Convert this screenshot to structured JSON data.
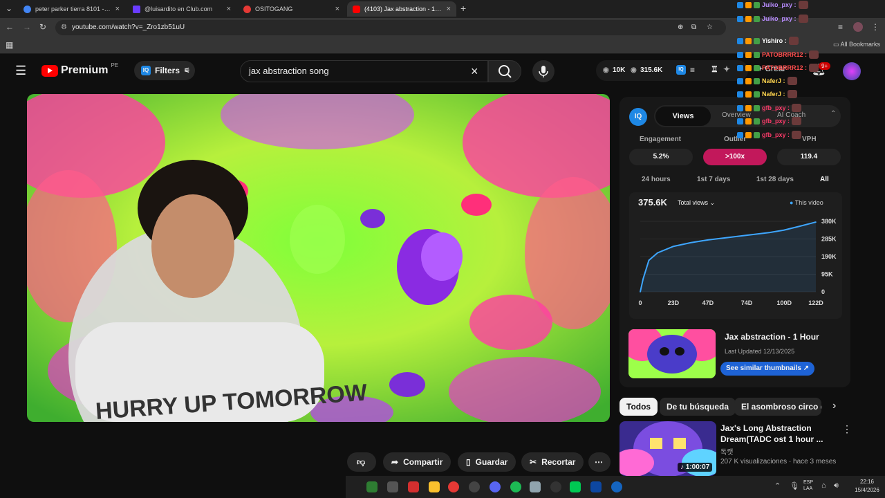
{
  "browser": {
    "tabs": [
      {
        "label": "peter parker tierra 8101 - Busca",
        "color": "#4285f4"
      },
      {
        "label": "@luisardito en Club.com",
        "color": "#6a3cff"
      },
      {
        "label": "OSITOGANG",
        "color": "#e53935"
      },
      {
        "label": "(4103) Jax abstraction - 1 Hour",
        "color": "#ff0000"
      }
    ],
    "url": "youtube.com/watch?v=_Zro1zb51uU",
    "all_bookmarks": "All Bookmarks"
  },
  "header": {
    "logo_text": "Premium",
    "logo_region": "PE",
    "filters_label": "Filters",
    "search_query": "jax abstraction song",
    "stat_likes": "10K",
    "stat_views": "315.6K",
    "create_label": "Crear",
    "notif_count": "9+"
  },
  "actions": {
    "share": "Compartir",
    "save": "Guardar",
    "clip": "Recortar"
  },
  "vidiq": {
    "tab_views": "Views",
    "tab_overview": "Overview",
    "tab_coach": "AI Coach",
    "metric_labels": [
      "Engagement",
      "Outlier",
      "VPH"
    ],
    "metric_values": [
      "5.2%",
      ">100x",
      "119.4"
    ],
    "ranges": [
      "24 hours",
      "1st 7 days",
      "1st 28 days",
      "All"
    ],
    "total": "375.6K",
    "total_label": "Total views",
    "legend": "This video",
    "thumb_title": "Jax abstraction - 1 Hour",
    "thumb_updated": "Last Updated 12/13/2025",
    "similar_btn": "See similar thumbnails"
  },
  "chart_data": {
    "type": "line",
    "x_ticks": [
      "0",
      "23D",
      "47D",
      "74D",
      "100D",
      "122D"
    ],
    "y_ticks": [
      "380K",
      "285K",
      "190K",
      "95K",
      "0"
    ],
    "x": [
      0,
      2,
      6,
      12,
      23,
      35,
      47,
      60,
      74,
      90,
      100,
      110,
      122
    ],
    "values": [
      0,
      70,
      170,
      210,
      245,
      265,
      280,
      292,
      305,
      320,
      333,
      352,
      376
    ],
    "ylim": [
      0,
      380
    ],
    "xlim": [
      0,
      122
    ],
    "series": [
      {
        "name": "This video",
        "color": "#3ea6ff"
      }
    ]
  },
  "chips": [
    "Todos",
    "De tu búsqueda",
    "El asombroso circo di"
  ],
  "related": {
    "title": "Jax's Long Abstraction Dream(TADC ost 1 hour ...",
    "channel": "독캣",
    "meta": "207 K visualizaciones · hace 3 meses",
    "duration": "1:00:07"
  },
  "chat": [
    {
      "user": "Juiko_pxy :",
      "color": "#b98cff"
    },
    {
      "user": "Juiko_pxy :",
      "color": "#b98cff"
    },
    {
      "user": "Yishiro :",
      "color": "#ffffff"
    },
    {
      "user": "PATOBRRR12 :",
      "color": "#ff4d4d"
    },
    {
      "user": "PATOBRRR12 :",
      "color": "#ff4d4d"
    },
    {
      "user": "NaferJ :",
      "color": "#ffd54f"
    },
    {
      "user": "NaferJ :",
      "color": "#ffd54f"
    },
    {
      "user": "gfb_pxy :",
      "color": "#ff3b6b"
    },
    {
      "user": "gfb_pxy :",
      "color": "#ff3b6b"
    },
    {
      "user": "gfb_pxy :",
      "color": "#ff3b6b"
    }
  ],
  "taskbar": {
    "lang": "ESP\nLAA",
    "time": "22:16",
    "date": "15/4/2026"
  },
  "shirt_text": "HURRY UP TOMORROW"
}
